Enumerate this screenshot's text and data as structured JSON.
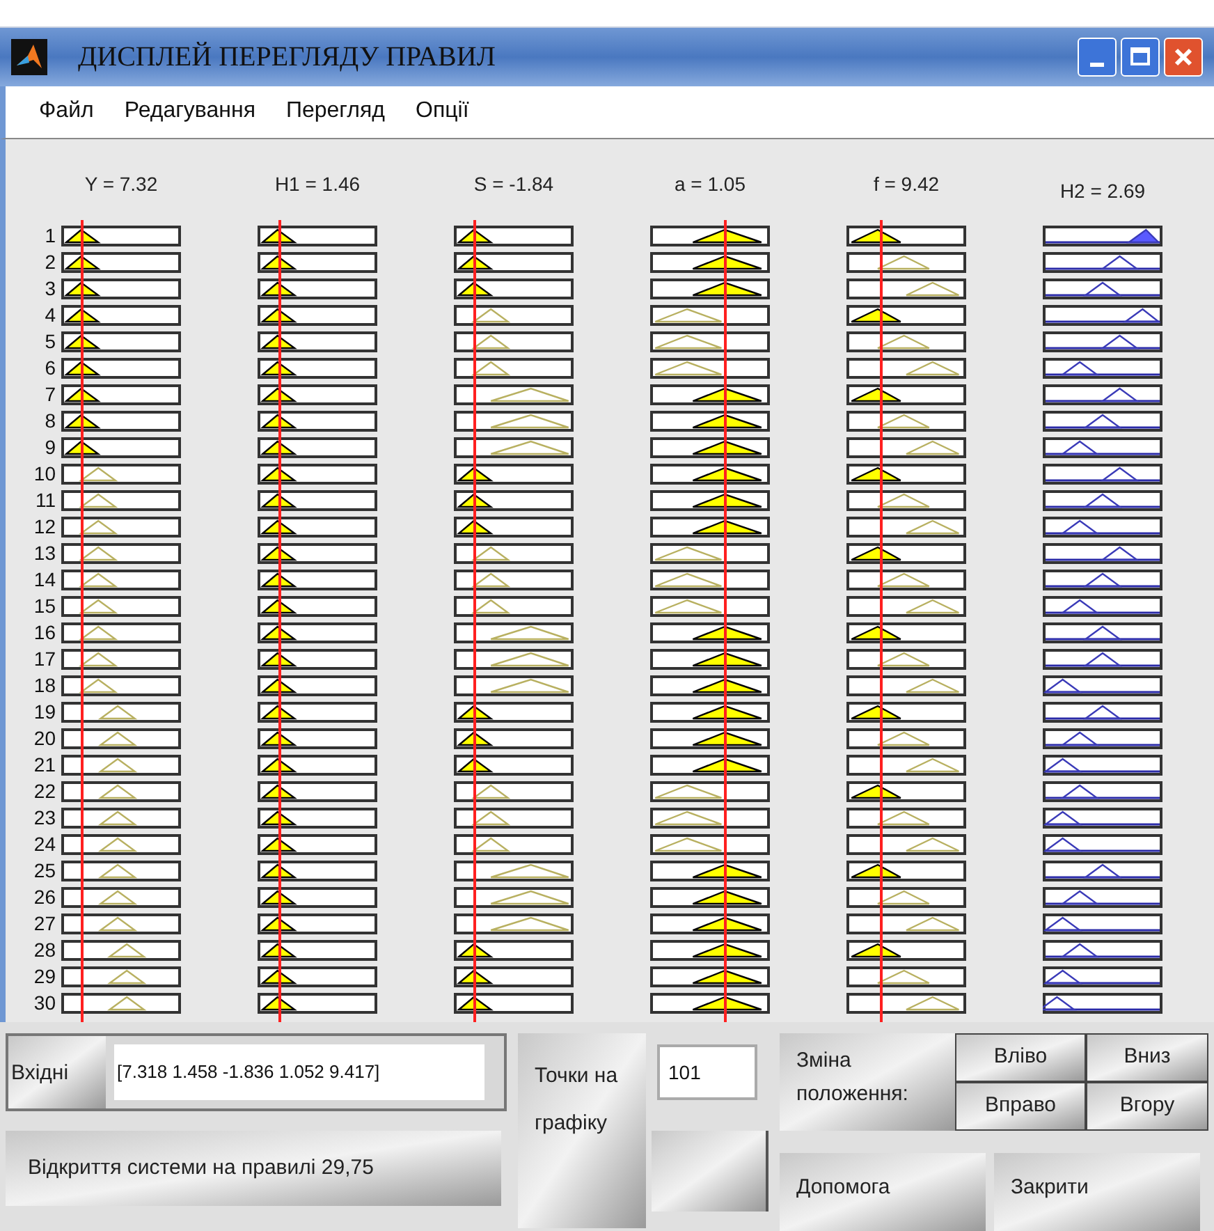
{
  "window": {
    "title": "ДИСПЛЕЙ ПЕРЕГЛЯДУ ПРАВИЛ"
  },
  "menu": [
    "Файл",
    "Редагування",
    "Перегляд",
    "Опції"
  ],
  "variables": [
    {
      "label": "Y = 7.32",
      "kind": "input"
    },
    {
      "label": "H1 = 1.46",
      "kind": "input"
    },
    {
      "label": "S = -1.84",
      "kind": "input"
    },
    {
      "label": "a = 1.05",
      "kind": "input"
    },
    {
      "label": "f = 9.42",
      "kind": "input"
    },
    {
      "label": "H2 = 2.69",
      "kind": "output"
    }
  ],
  "rules": [
    "1",
    "2",
    "3",
    "4",
    "5",
    "6",
    "7",
    "8",
    "9",
    "10",
    "11",
    "12",
    "13",
    "14",
    "15",
    "16",
    "17",
    "18",
    "19",
    "20",
    "21",
    "22",
    "23",
    "24",
    "25",
    "26",
    "27",
    "28",
    "29",
    "30"
  ],
  "input_panel": {
    "label": "Вхідні",
    "value": "[7.318 1.458 -1.836 1.052 9.417]"
  },
  "points": {
    "label": "Точки на графіку",
    "value": "101"
  },
  "status": "Відкриття системи на правилі 29,75",
  "move": {
    "label": "Зміна положення:",
    "buttons": [
      "Вліво",
      "Вниз",
      "Вправо",
      "Вгору"
    ]
  },
  "buttons": [
    "Допомога",
    "Закрити"
  ]
}
